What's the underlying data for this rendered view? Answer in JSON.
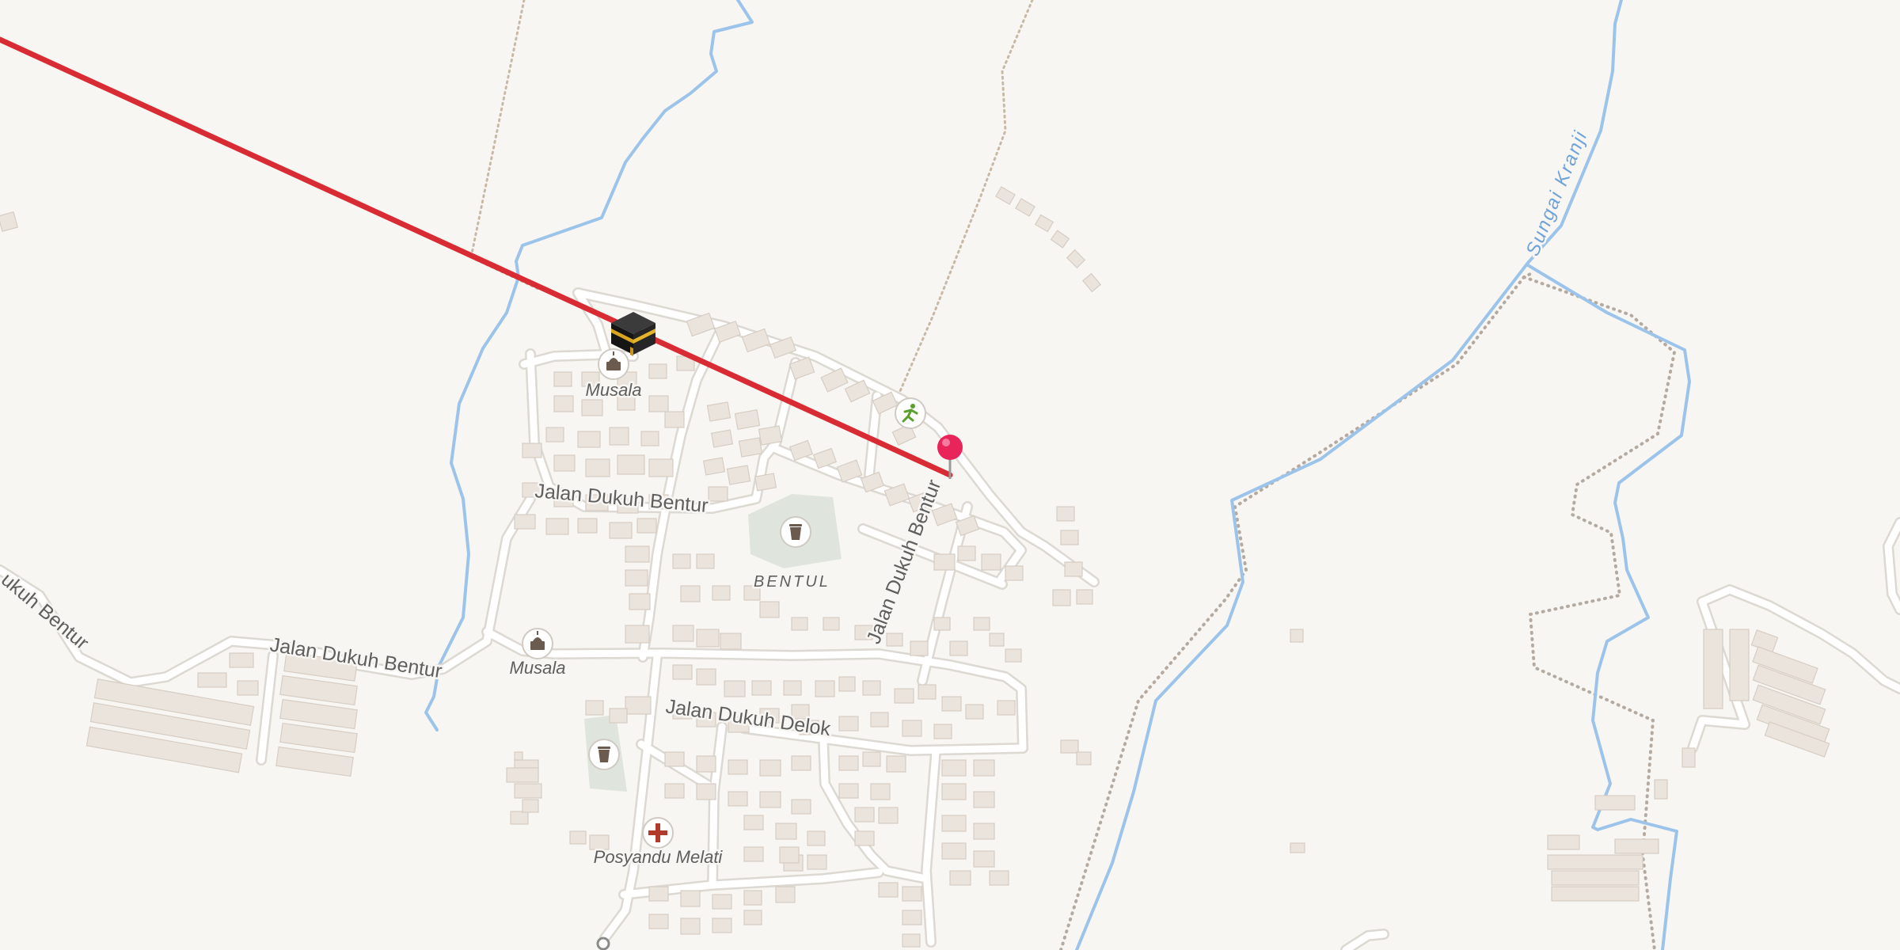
{
  "map": {
    "road_labels": {
      "bentur_1": "Jalan Dukuh Bentur",
      "bentur_2": "Jalan Dukuh Bentur",
      "bentur_3": "Jalan Dukuh Bentur",
      "bentur_edge": "ukuh Bentur",
      "delok": "Jalan Dukuh Delok"
    },
    "water_labels": {
      "river": "Sungai Kranji"
    },
    "place_labels": {
      "village": "BENTUL"
    },
    "poi_labels": {
      "musala_1": "Musala",
      "musala_2": "Musala",
      "posyandu": "Posyandu Melati"
    },
    "icons": {
      "kaaba": "kaaba-icon",
      "pin": "location-pin-icon",
      "sports": "sports-pitch-icon",
      "mosque": "mosque-icon",
      "cemetery": "cemetery-icon",
      "health": "health-cross-icon"
    },
    "colors": {
      "background": "#f8f6f2",
      "road": "#ffffff",
      "water": "#9cc4ea",
      "qibla_line": "#d92b33",
      "pin": "#e8245a",
      "health": "#b23a2b",
      "sports": "#5aa02c"
    }
  }
}
